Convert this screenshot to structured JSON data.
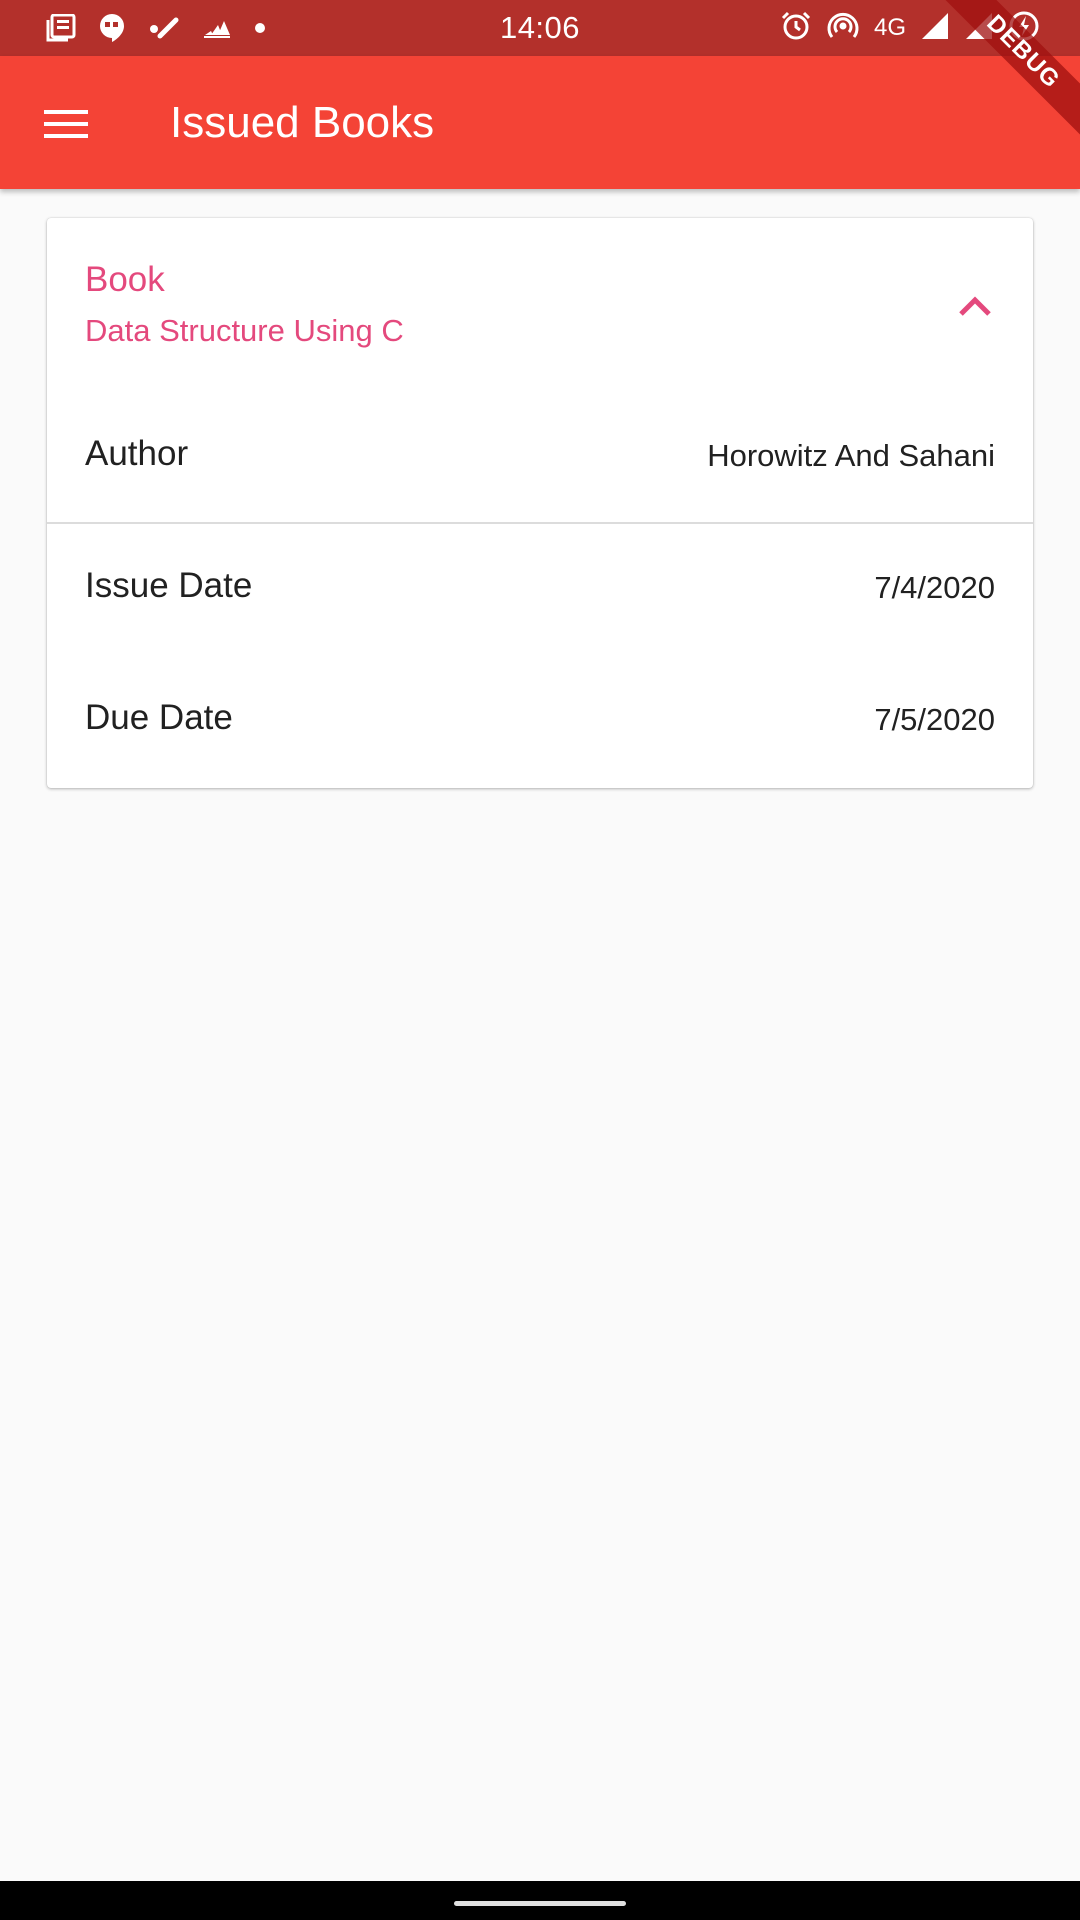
{
  "status_bar": {
    "time": "14:06",
    "network": "4G",
    "left_icons": [
      "news-icon",
      "hangouts-icon",
      "phone-call-icon",
      "adidas-icon",
      "dot-icon"
    ],
    "right_icons": [
      "alarm-icon",
      "hotspot-icon",
      "signal-icon",
      "battery-charging-icon"
    ]
  },
  "debug_ribbon": "DEBUG",
  "app_bar": {
    "title": "Issued Books",
    "menu_icon": "hamburger-menu-icon",
    "color": "#f44336"
  },
  "card": {
    "header_label": "Book",
    "header_value": "Data Structure Using C",
    "expand_icon": "chevron-up-icon",
    "accent_color": "#e4497d",
    "rows": [
      {
        "label": "Author",
        "value": "Horowitz And Sahani"
      },
      {
        "label": "Issue Date",
        "value": "7/4/2020"
      },
      {
        "label": "Due Date",
        "value": "7/5/2020"
      }
    ]
  },
  "colors": {
    "status_bar": "#b3302b",
    "background": "#fafafa"
  }
}
